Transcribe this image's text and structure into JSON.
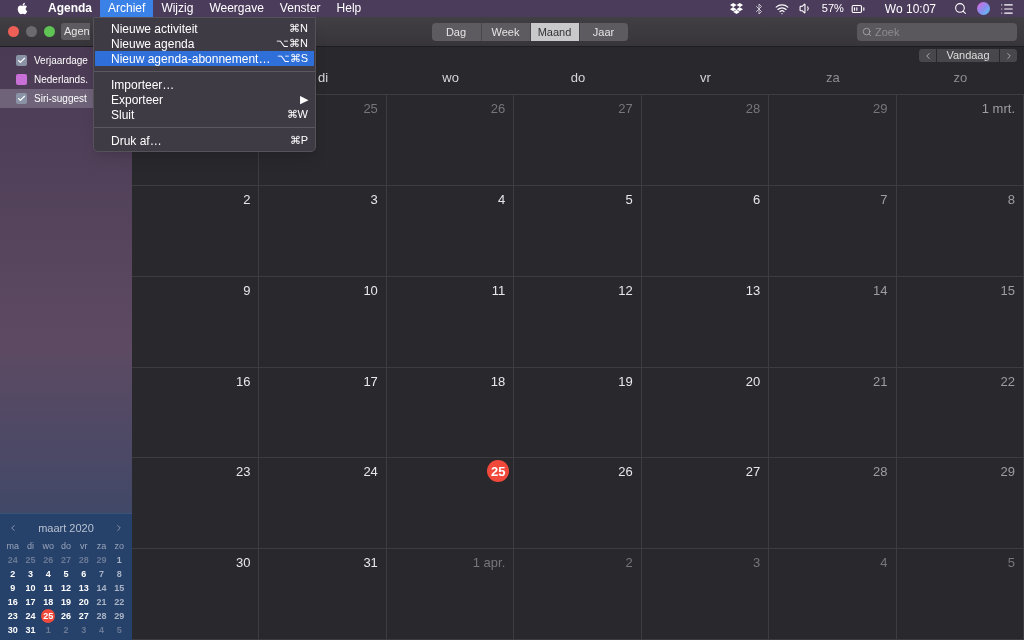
{
  "menu_bar": {
    "menus": [
      {
        "label": "Agenda",
        "kind": "app",
        "selected": false
      },
      {
        "label": "Archief",
        "kind": "menu",
        "selected": true
      },
      {
        "label": "Wijzig",
        "kind": "menu",
        "selected": false
      },
      {
        "label": "Weergave",
        "kind": "menu",
        "selected": false
      },
      {
        "label": "Venster",
        "kind": "menu",
        "selected": false
      },
      {
        "label": "Help",
        "kind": "menu",
        "selected": false
      }
    ],
    "battery": "57%",
    "clock": "Wo 10:07"
  },
  "file_menu": {
    "items": [
      {
        "kind": "item",
        "label": "Nieuwe activiteit",
        "shortcut": "⌘N",
        "selected": false
      },
      {
        "kind": "item",
        "label": "Nieuwe agenda",
        "shortcut": "⌥⌘N",
        "selected": false
      },
      {
        "kind": "item",
        "label": "Nieuw agenda-abonnement…",
        "shortcut": "⌥⌘S",
        "selected": true
      },
      {
        "kind": "separator"
      },
      {
        "kind": "item",
        "label": "Importeer…",
        "selected": false
      },
      {
        "kind": "item",
        "label": "Exporteer",
        "shortcut": "▶",
        "selected": false
      },
      {
        "kind": "item",
        "label": "Sluit",
        "shortcut": "⌘W",
        "selected": false
      },
      {
        "kind": "separator"
      },
      {
        "kind": "item",
        "label": "Druk af…",
        "shortcut": "⌘P",
        "selected": false
      }
    ]
  },
  "toolbar": {
    "calendars_button": "Agen",
    "views": [
      {
        "label": "Dag",
        "selected": false
      },
      {
        "label": "Week",
        "selected": false
      },
      {
        "label": "Maand",
        "selected": true
      },
      {
        "label": "Jaar",
        "selected": false
      }
    ],
    "search": {
      "placeholder": "Zoek"
    },
    "today_button": "Vandaag"
  },
  "sidebar": {
    "calendars": [
      {
        "name": "Verjaardage",
        "checked": true,
        "color": "#8a93a6",
        "selected": false
      },
      {
        "name": "Nederlands.",
        "checked": false,
        "color": "#c86fd8",
        "selected": false
      },
      {
        "name": "Siri-suggest",
        "checked": true,
        "color": "#8a93a6",
        "selected": true
      }
    ],
    "mini_calendar": {
      "title": "maart 2020",
      "weekdays": [
        "ma",
        "di",
        "wo",
        "do",
        "vr",
        "za",
        "zo"
      ],
      "weeks": [
        [
          {
            "day": "24",
            "muted": true
          },
          {
            "day": "25",
            "muted": true
          },
          {
            "day": "26",
            "muted": true
          },
          {
            "day": "27",
            "muted": true
          },
          {
            "day": "28",
            "muted": true
          },
          {
            "day": "29",
            "muted": true
          },
          {
            "day": "1",
            "muted": false
          }
        ],
        [
          {
            "day": "2",
            "muted": false
          },
          {
            "day": "3",
            "muted": false
          },
          {
            "day": "4",
            "muted": false
          },
          {
            "day": "5",
            "muted": false
          },
          {
            "day": "6",
            "muted": false
          },
          {
            "day": "7",
            "muted": false
          },
          {
            "day": "8",
            "muted": false
          }
        ],
        [
          {
            "day": "9",
            "muted": false
          },
          {
            "day": "10",
            "muted": false
          },
          {
            "day": "11",
            "muted": false
          },
          {
            "day": "12",
            "muted": false
          },
          {
            "day": "13",
            "muted": false
          },
          {
            "day": "14",
            "muted": false
          },
          {
            "day": "15",
            "muted": false
          }
        ],
        [
          {
            "day": "16",
            "muted": false
          },
          {
            "day": "17",
            "muted": false
          },
          {
            "day": "18",
            "muted": false
          },
          {
            "day": "19",
            "muted": false
          },
          {
            "day": "20",
            "muted": false
          },
          {
            "day": "21",
            "muted": false
          },
          {
            "day": "22",
            "muted": false
          }
        ],
        [
          {
            "day": "23",
            "muted": false
          },
          {
            "day": "24",
            "muted": false
          },
          {
            "day": "25",
            "muted": false,
            "today": true
          },
          {
            "day": "26",
            "muted": false
          },
          {
            "day": "27",
            "muted": false
          },
          {
            "day": "28",
            "muted": false
          },
          {
            "day": "29",
            "muted": false
          }
        ],
        [
          {
            "day": "30",
            "muted": false
          },
          {
            "day": "31",
            "muted": false
          },
          {
            "day": "1",
            "muted": true
          },
          {
            "day": "2",
            "muted": true
          },
          {
            "day": "3",
            "muted": true
          },
          {
            "day": "4",
            "muted": true
          },
          {
            "day": "5",
            "muted": true
          }
        ]
      ]
    }
  },
  "calendar": {
    "weekdays": [
      "di",
      "wo",
      "do",
      "vr",
      "za",
      "zo"
    ],
    "weeks": [
      [
        {
          "day": "25",
          "muted": true
        },
        {
          "day": "26",
          "muted": true
        },
        {
          "day": "27",
          "muted": true
        },
        {
          "day": "28",
          "muted": true
        },
        {
          "day": "29",
          "muted": true
        },
        {
          "day": "1 mrt.",
          "muted": false
        }
      ],
      [
        {
          "day": "2",
          "muted": false
        },
        {
          "day": "3",
          "muted": false
        },
        {
          "day": "4",
          "muted": false
        },
        {
          "day": "5",
          "muted": false
        },
        {
          "day": "6",
          "muted": false
        },
        {
          "day": "7",
          "muted": false
        },
        {
          "day": "8",
          "muted": false
        }
      ],
      [
        {
          "day": "9",
          "muted": false
        },
        {
          "day": "10",
          "muted": false
        },
        {
          "day": "11",
          "muted": false
        },
        {
          "day": "12",
          "muted": false
        },
        {
          "day": "13",
          "muted": false
        },
        {
          "day": "14",
          "muted": false
        },
        {
          "day": "15",
          "muted": false
        }
      ],
      [
        {
          "day": "16",
          "muted": false
        },
        {
          "day": "17",
          "muted": false
        },
        {
          "day": "18",
          "muted": false
        },
        {
          "day": "19",
          "muted": false
        },
        {
          "day": "20",
          "muted": false
        },
        {
          "day": "21",
          "muted": false
        },
        {
          "day": "22",
          "muted": false
        }
      ],
      [
        {
          "day": "23",
          "muted": false
        },
        {
          "day": "24",
          "muted": false
        },
        {
          "day": "25",
          "muted": false,
          "today": true
        },
        {
          "day": "26",
          "muted": false
        },
        {
          "day": "27",
          "muted": false
        },
        {
          "day": "28",
          "muted": false
        },
        {
          "day": "29",
          "muted": false
        }
      ],
      [
        {
          "day": "30",
          "muted": false
        },
        {
          "day": "31",
          "muted": false
        },
        {
          "day": "1 apr.",
          "muted": true
        },
        {
          "day": "2",
          "muted": true
        },
        {
          "day": "3",
          "muted": true
        },
        {
          "day": "4",
          "muted": true
        },
        {
          "day": "5",
          "muted": true
        }
      ]
    ]
  }
}
